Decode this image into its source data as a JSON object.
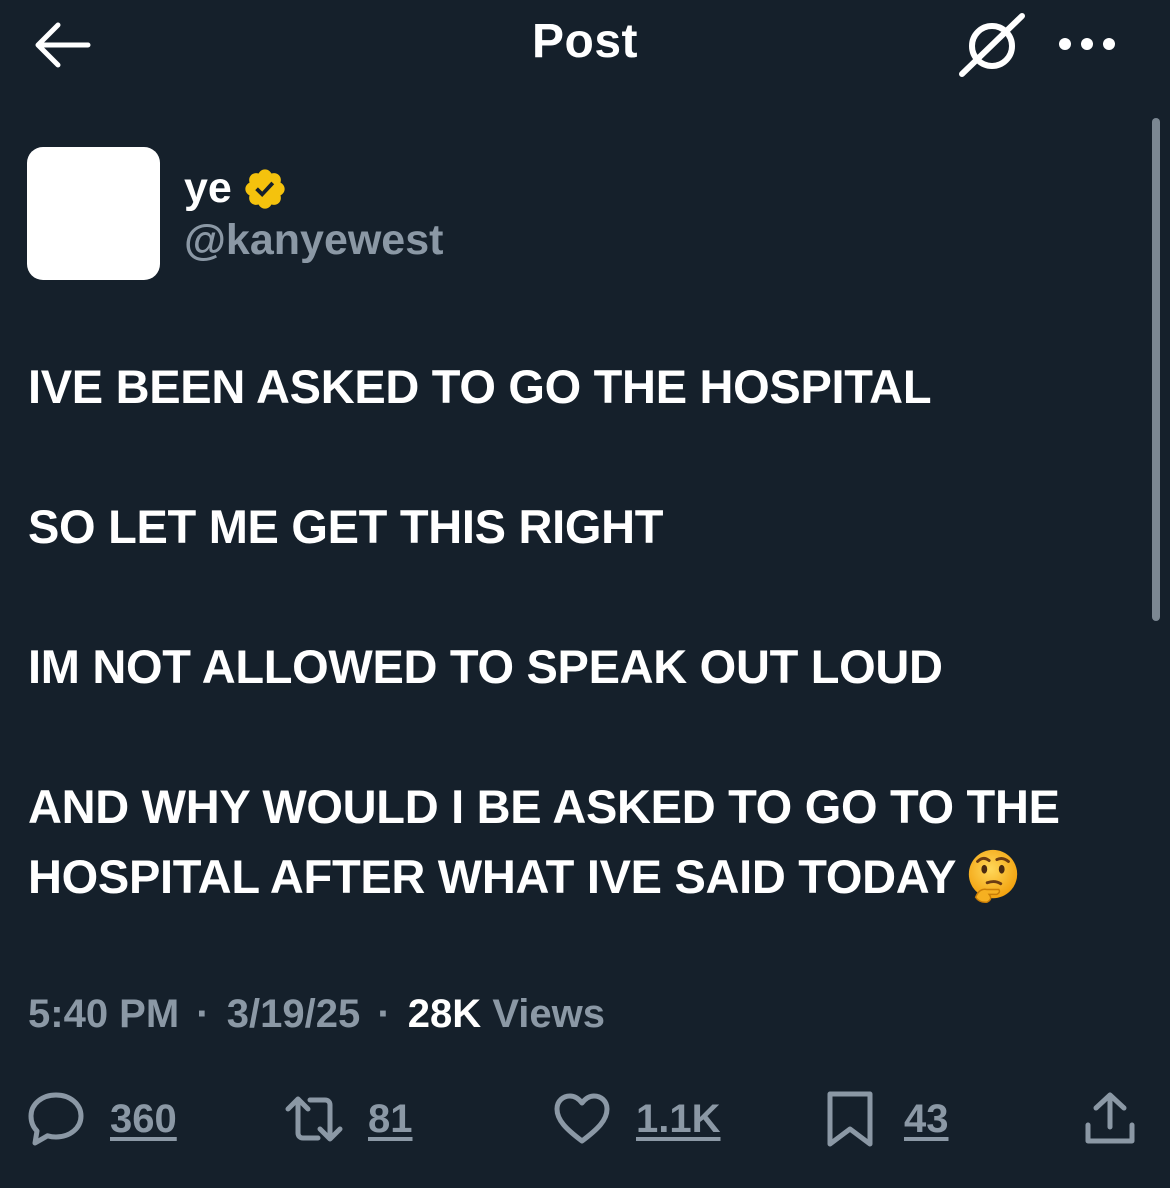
{
  "header": {
    "title": "Post"
  },
  "author": {
    "display_name": "ye",
    "handle": "@kanyewest",
    "verified": true,
    "verified_color": "#f4c20d"
  },
  "post": {
    "paragraphs": [
      "IVE BEEN ASKED TO GO THE HOSPITAL",
      "SO LET ME GET THIS RIGHT",
      "IM NOT ALLOWED TO SPEAK  OUT LOUD",
      "AND WHY WOULD I BE ASKED TO GO TO THE HOSPITAL AFTER WHAT IVE SAID TODAY"
    ],
    "trailing_emoji": "thinking-face-emoji"
  },
  "meta": {
    "time": "5:40 PM",
    "separator": "·",
    "date": "3/19/25",
    "views_count": "28K",
    "views_label": "Views"
  },
  "actions": {
    "replies": "360",
    "reposts": "81",
    "likes": "1.1K",
    "bookmarks": "43"
  },
  "icons": {
    "back": "arrow-left-icon",
    "grok": "grok-icon",
    "more": "more-dots-icon",
    "reply": "reply-bubble-icon",
    "repost": "repost-arrows-icon",
    "like": "heart-icon",
    "bookmark": "bookmark-icon",
    "share": "share-upload-icon"
  },
  "colors": {
    "background": "#15202b",
    "text": "#ffffff",
    "secondary_text": "#8b98a5"
  }
}
